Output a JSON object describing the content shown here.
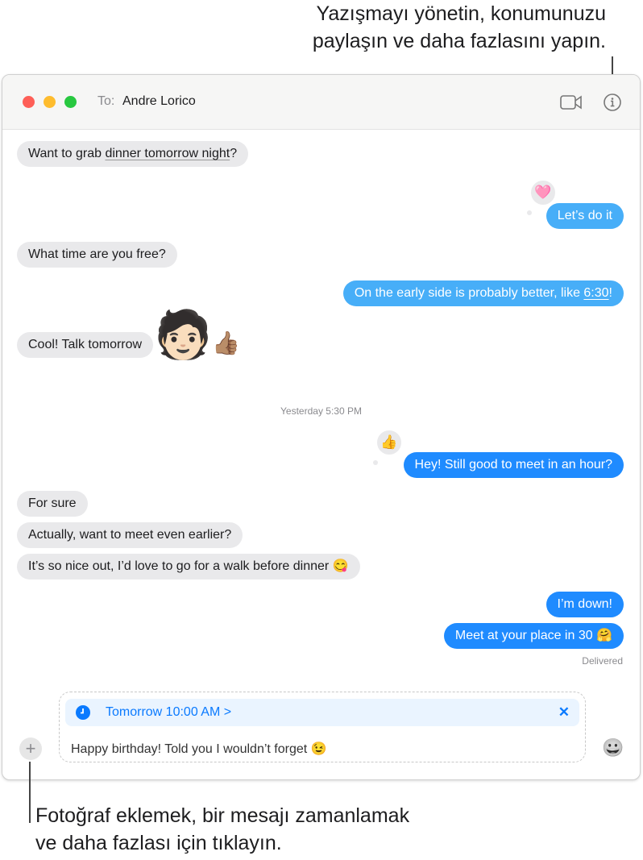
{
  "callouts": {
    "top_line1": "Yazışmayı yönetin, konumunuzu",
    "top_line2": "paylaşın ve daha fazlasını yapın.",
    "bottom_line1": "Fotoğraf eklemek, bir mesajı zamanlamak",
    "bottom_line2": "ve daha fazlası için tıklayın."
  },
  "header": {
    "to_label": "To:",
    "recipient": "Andre Lorico",
    "icons": [
      "video-camera-icon",
      "info-icon"
    ]
  },
  "messages": {
    "m1a": "Want to grab ",
    "m1b": "dinner tomorrow night",
    "m1c": "?",
    "m2": "Let’s do it",
    "m2_tapback": "🩷",
    "m3": "What time are you free?",
    "m4a": "On the early side is probably better, like ",
    "m4b": "6:30",
    "m4c": "!",
    "m5": "Cool! Talk tomorrow",
    "m5_memoji": "🧑🏻",
    "timestamp": "Yesterday 5:30 PM",
    "m6": "Hey! Still good to meet in an hour?",
    "m6_tapback": "👍",
    "m7": "For sure",
    "m8": "Actually, want to meet even earlier?",
    "m9": "It’s so nice out, I’d love to go for a walk before dinner 😋",
    "m10": "I’m down!",
    "m11": "Meet at your place in 30 🤗",
    "status": "Delivered"
  },
  "compose": {
    "schedule": "Tomorrow 10:00 AM >",
    "text": "Happy birthday! Told you I wouldn’t forget 😉",
    "plus": "+",
    "emoji": "😀",
    "close": "✕"
  },
  "colors": {
    "sent": "#1f8bff",
    "sent_light": "#47aef8",
    "received": "#e9e9eb",
    "accent": "#0a7aff"
  }
}
